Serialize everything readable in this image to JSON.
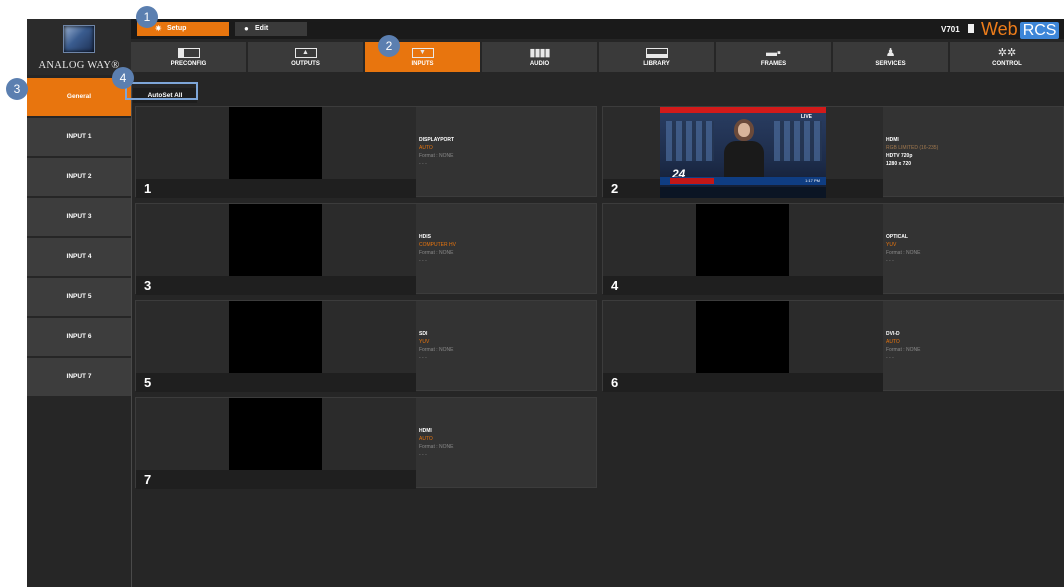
{
  "logo": {
    "text": "ANALOG WAY®"
  },
  "topbar": {
    "setup_label": "Setup",
    "edit_label": "Edit",
    "version": "V701",
    "brand_web": "Web",
    "brand_rcs": "RCS"
  },
  "nav": {
    "tabs": [
      {
        "label": "PRECONFIG",
        "icon": "preconfig-icon"
      },
      {
        "label": "OUTPUTS",
        "icon": "outputs-icon"
      },
      {
        "label": "INPUTS",
        "icon": "inputs-icon",
        "active": true
      },
      {
        "label": "AUDIO",
        "icon": "audio-icon"
      },
      {
        "label": "LIBRARY",
        "icon": "library-icon"
      },
      {
        "label": "FRAMES",
        "icon": "frames-icon"
      },
      {
        "label": "SERVICES",
        "icon": "services-icon"
      },
      {
        "label": "CONTROL",
        "icon": "control-icon"
      }
    ]
  },
  "sidebar": {
    "items": [
      "General",
      "INPUT 1",
      "INPUT 2",
      "INPUT 3",
      "INPUT 4",
      "INPUT 5",
      "INPUT 6",
      "INPUT 7"
    ],
    "active_index": 0
  },
  "toolbar": {
    "autoset_label": "AutoSet All"
  },
  "inputs": [
    {
      "number": "1",
      "type": "DISPLAYPORT",
      "mode": "AUTO",
      "format": "Format : NONE",
      "extra": "- - -"
    },
    {
      "number": "2",
      "type": "HDMI",
      "mode": "RGB LIMITED (16-235)",
      "line1": "HDTV 720p",
      "line2": "1280 x 720",
      "live": true
    },
    {
      "number": "3",
      "type": "HDIS",
      "mode": "COMPUTER HV",
      "format": "Format : NONE",
      "extra": "- - -"
    },
    {
      "number": "4",
      "type": "OPTICAL",
      "mode": "YUV",
      "format": "Format : NONE",
      "extra": "- - -"
    },
    {
      "number": "5",
      "type": "SDI",
      "mode": "YUV",
      "format": "Format : NONE",
      "extra": "- - -"
    },
    {
      "number": "6",
      "type": "DVI-D",
      "mode": "AUTO",
      "format": "Format : NONE",
      "extra": "- - -"
    },
    {
      "number": "7",
      "type": "HDMI",
      "mode": "AUTO",
      "format": "Format : NONE",
      "extra": "- - -"
    }
  ],
  "live_preview": {
    "channel": "24",
    "badge": "LIVE",
    "ticker_time": "1:17 PM"
  },
  "callouts": [
    "1",
    "2",
    "3",
    "4"
  ],
  "colors": {
    "accent": "#e8750e",
    "callout": "#5b7fb0",
    "highlight": "#7ea6d8",
    "rcs": "#3d86d8"
  }
}
